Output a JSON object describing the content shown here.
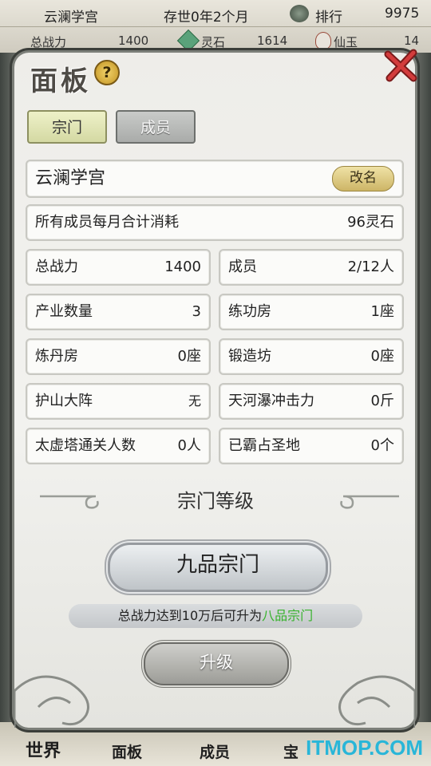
{
  "topbar": {
    "sect_name": "云澜学宫",
    "time": "存世0年2个月",
    "rank_label": "排行",
    "rank_value": "9975",
    "power_label": "总战力",
    "power_value": "1400",
    "stone_label": "灵石",
    "stone_value": "1614",
    "jade_label": "仙玉",
    "jade_value": "14"
  },
  "panel": {
    "title": "面板",
    "help": "?",
    "tabs": [
      {
        "label": "宗门",
        "active": true
      },
      {
        "label": "成员",
        "active": false
      }
    ],
    "sect_name": "云澜学宫",
    "rename_label": "改名",
    "monthly": {
      "label": "所有成员每月合计消耗",
      "value": "96灵石"
    },
    "stats": [
      {
        "label": "总战力",
        "value": "1400"
      },
      {
        "label": "成员",
        "value": "2/12人"
      },
      {
        "label": "产业数量",
        "value": "3"
      },
      {
        "label": "练功房",
        "value": "1座"
      },
      {
        "label": "炼丹房",
        "value": "0座"
      },
      {
        "label": "锻造坊",
        "value": "0座"
      },
      {
        "label": "护山大阵",
        "value": "无"
      },
      {
        "label": "天河瀑冲击力",
        "value": "0斤"
      },
      {
        "label": "太虚塔通关人数",
        "value": "0人"
      },
      {
        "label": "已霸占圣地",
        "value": "0个"
      }
    ],
    "level_title": "宗门等级",
    "grade": "九品宗门",
    "hint_prefix": "总战力达到10万后可升为",
    "hint_target": "八品宗门",
    "upgrade_label": "升级"
  },
  "bottom_nav": [
    "世界",
    "面板",
    "成员",
    "宝"
  ],
  "watermark": "ITMOP.COM",
  "colors": {
    "accent_green": "#37b22c",
    "watermark": "#29b6d8"
  }
}
